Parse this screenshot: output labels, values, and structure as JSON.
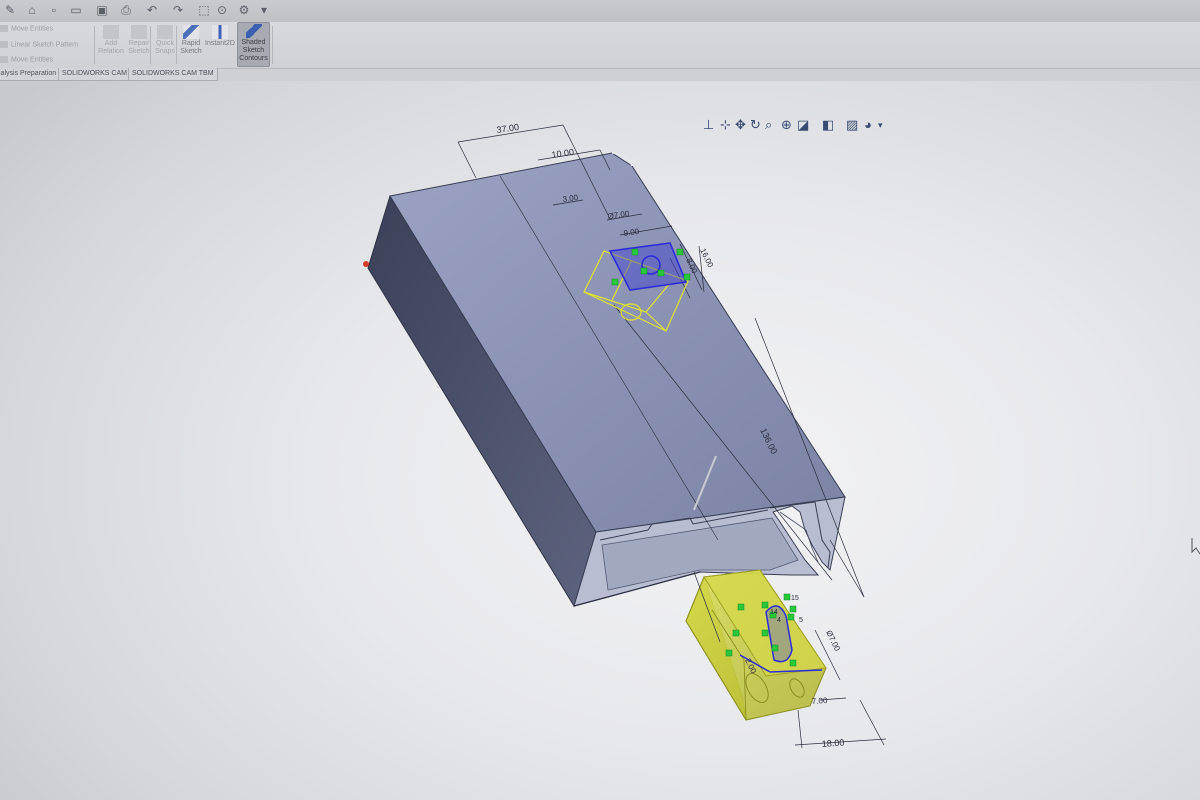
{
  "quick_access": {
    "icons": [
      "pin-icon",
      "home-icon",
      "new-icon",
      "open-icon",
      "save-icon",
      "print-icon",
      "undo-icon",
      "redo-icon",
      "select-icon",
      "rebuild-icon",
      "options-icon"
    ]
  },
  "ribbon": {
    "sketch_small": [
      "Move Entities",
      "Linear Sketch Pattern",
      "Move Entities"
    ],
    "groups": [
      {
        "label1": "Add",
        "label2": "Relation",
        "state": "dim"
      },
      {
        "label1": "Repair",
        "label2": "Sketch",
        "state": "dim"
      },
      {
        "label1": "Quick",
        "label2": "Snaps",
        "state": "dim"
      },
      {
        "label1": "Rapid",
        "label2": "Sketch",
        "state": "normal"
      },
      {
        "label1": "Instant2D",
        "label2": "",
        "state": "normal"
      },
      {
        "label1": "Shaded",
        "label2": "Sketch",
        "label3": "Contours",
        "state": "active"
      }
    ]
  },
  "tabs": [
    "Analysis Preparation",
    "SOLIDWORKS CAM",
    "SOLIDWORKS CAM TBM"
  ],
  "heads_up_icons": [
    "zoom-to-fit-icon",
    "zoom-area-icon",
    "previous-view-icon",
    "section-view-icon",
    "view-orientation-icon",
    "display-style-icon",
    "hide-show-icon",
    "appearance-icon",
    "scene-icon"
  ],
  "dimensions": {
    "d_37": "37.00",
    "d_10": "10.00",
    "d_3": "3.00",
    "d_dia7_top": "Ø7.00",
    "d_9": "9.00",
    "d_16": "16.00",
    "d_8": "8.00",
    "d_136": "136.00",
    "d_dia7_bottom": "Ø7.00",
    "d_7": "7.00",
    "d_18": "18.00",
    "d_2": "2.00",
    "d_14": "14",
    "d_15": "15",
    "d_4": "4",
    "d_5": "5"
  },
  "colors": {
    "body_top": "#8c93b4",
    "body_side": "#4e5370",
    "sketch_yellow": "#e9ec2a",
    "sketch_blue": "#2b2cd8",
    "relation_green": "#27c93a"
  }
}
